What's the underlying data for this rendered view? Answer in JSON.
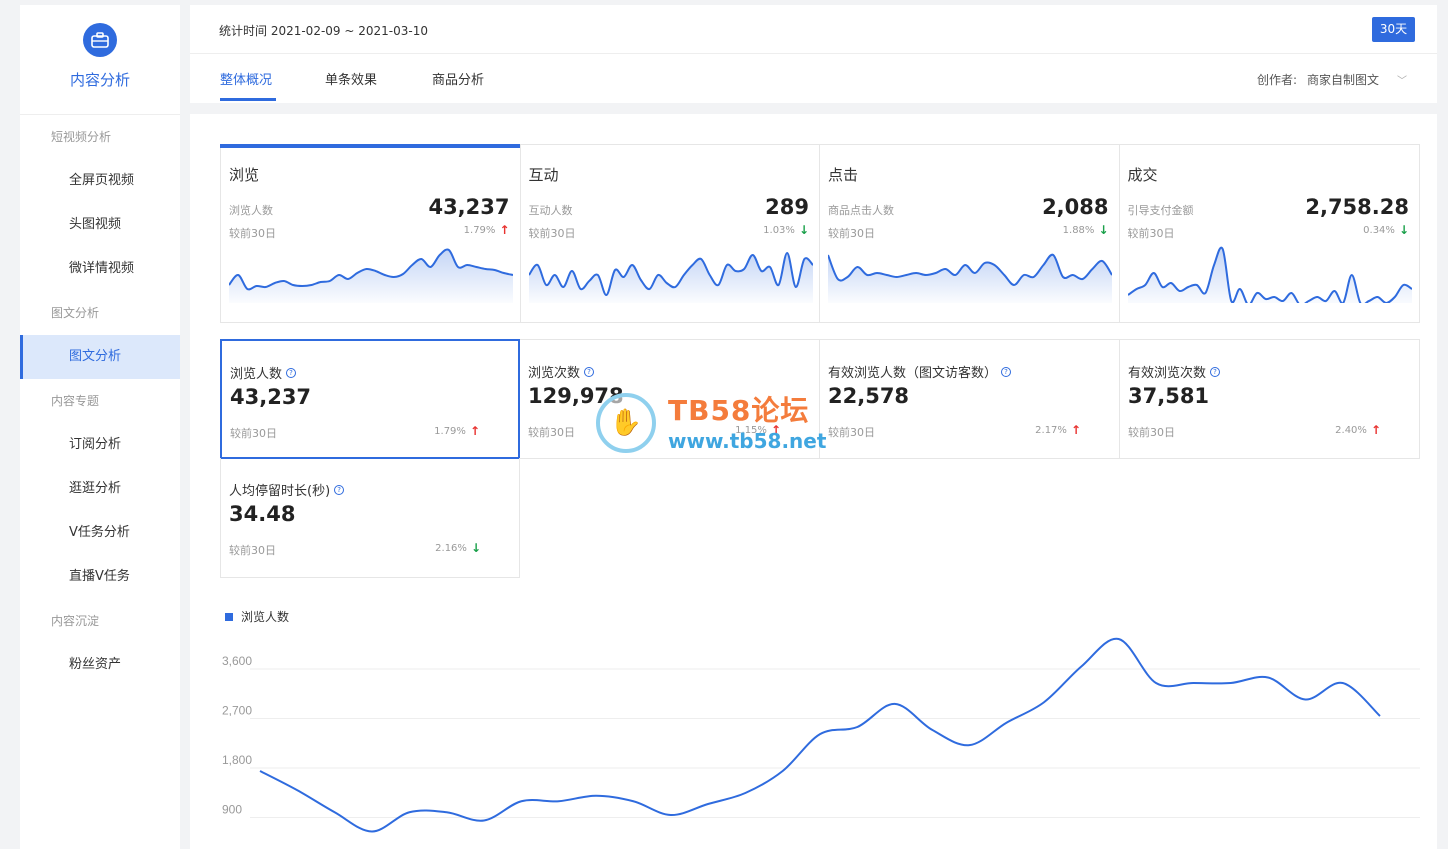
{
  "sidebar": {
    "title": "内容分析",
    "groups": [
      {
        "label": "短视频分析",
        "items": [
          "全屏页视频",
          "头图视频",
          "微详情视频"
        ]
      },
      {
        "label": "图文分析",
        "items": [
          "图文分析"
        ]
      },
      {
        "label": "内容专题",
        "items": [
          "订阅分析",
          "逛逛分析",
          "V任务分析",
          "直播V任务"
        ]
      },
      {
        "label": "内容沉淀",
        "items": [
          "粉丝资产"
        ]
      }
    ],
    "active_item": "图文分析"
  },
  "header": {
    "stat_time": "统计时间 2021-02-09 ~ 2021-03-10",
    "range_button": "30天",
    "tabs": [
      "整体概况",
      "单条效果",
      "商品分析"
    ],
    "active_tab": "整体概况",
    "creator_label": "创作者:",
    "creator_value": "商家自制图文"
  },
  "overview_cards": [
    {
      "title": "浏览",
      "label": "浏览人数",
      "value": "43,237",
      "compare": "较前30日",
      "pct": "1.79%",
      "trend": "up",
      "spark": [
        40,
        30,
        44,
        41,
        42,
        38,
        36,
        40,
        41,
        40,
        37,
        36,
        30,
        34,
        28,
        24,
        26,
        30,
        32,
        29,
        20,
        14,
        22,
        10,
        5,
        22,
        20,
        22,
        24,
        25,
        28,
        30
      ]
    },
    {
      "title": "互动",
      "label": "互动人数",
      "value": "289",
      "compare": "较前30日",
      "pct": "1.03%",
      "trend": "down",
      "spark": [
        30,
        20,
        40,
        30,
        42,
        26,
        44,
        36,
        30,
        50,
        25,
        32,
        20,
        35,
        44,
        30,
        38,
        42,
        30,
        20,
        14,
        30,
        40,
        20,
        26,
        24,
        10,
        26,
        22,
        40,
        8,
        42,
        14,
        20
      ]
    },
    {
      "title": "点击",
      "label": "商品点击人数",
      "value": "2,088",
      "compare": "较前30日",
      "pct": "1.88%",
      "trend": "down",
      "spark": [
        10,
        34,
        32,
        22,
        30,
        28,
        30,
        32,
        30,
        28,
        30,
        28,
        24,
        30,
        20,
        28,
        18,
        20,
        30,
        40,
        30,
        32,
        20,
        10,
        32,
        30,
        34,
        24,
        16,
        30
      ]
    },
    {
      "title": "成交",
      "label": "引导支付金额",
      "value": "2,758.28",
      "compare": "较前30日",
      "pct": "0.34%",
      "trend": "down",
      "spark": [
        50,
        44,
        40,
        28,
        42,
        38,
        46,
        42,
        40,
        48,
        20,
        4,
        56,
        44,
        60,
        48,
        54,
        52,
        56,
        48,
        60,
        56,
        52,
        56,
        46,
        58,
        30,
        58,
        56,
        52,
        58,
        52,
        40,
        44
      ]
    }
  ],
  "metrics": [
    {
      "title": "浏览人数",
      "value": "43,237",
      "compare": "较前30日",
      "pct": "1.79%",
      "trend": "up"
    },
    {
      "title": "浏览次数",
      "value": "129,978",
      "compare": "较前30日",
      "pct": "1.15%",
      "trend": "up"
    },
    {
      "title": "有效浏览人数（图文访客数）",
      "value": "22,578",
      "compare": "较前30日",
      "pct": "2.17%",
      "trend": "up"
    },
    {
      "title": "有效浏览次数",
      "value": "37,581",
      "compare": "较前30日",
      "pct": "2.40%",
      "trend": "up"
    },
    {
      "title": "人均停留时长(秒)",
      "value": "34.48",
      "compare": "较前30日",
      "pct": "2.16%",
      "trend": "down"
    }
  ],
  "watermark": {
    "title": "TB58论坛",
    "url": "www.tb58.net"
  },
  "chart_data": {
    "type": "line",
    "series": [
      {
        "name": "浏览人数",
        "values": [
          1600,
          1250,
          850,
          500,
          850,
          850,
          700,
          1050,
          1050,
          1150,
          1050,
          800,
          1000,
          1200,
          1600,
          2270,
          2400,
          2820,
          2350,
          2070,
          2480,
          2850,
          3500,
          4000,
          3200,
          3200,
          3200,
          3300,
          2900,
          3200,
          2600
        ]
      }
    ],
    "yticks": [
      "3,600",
      "2,700",
      "1,800",
      "900"
    ],
    "ylim": [
      0,
      4000
    ],
    "grid": true,
    "legend": "top-left"
  },
  "colors": {
    "accent": "#2f6bde",
    "up": "#e8322f",
    "down": "#1aa04a"
  }
}
